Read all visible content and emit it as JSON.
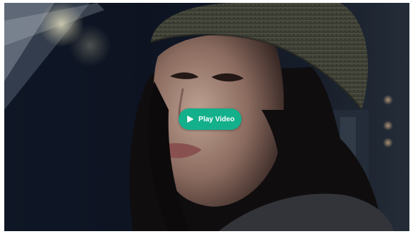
{
  "video": {
    "play_label": "Play Video",
    "play_icon": "play-icon",
    "accent_color": "#14b08c"
  }
}
